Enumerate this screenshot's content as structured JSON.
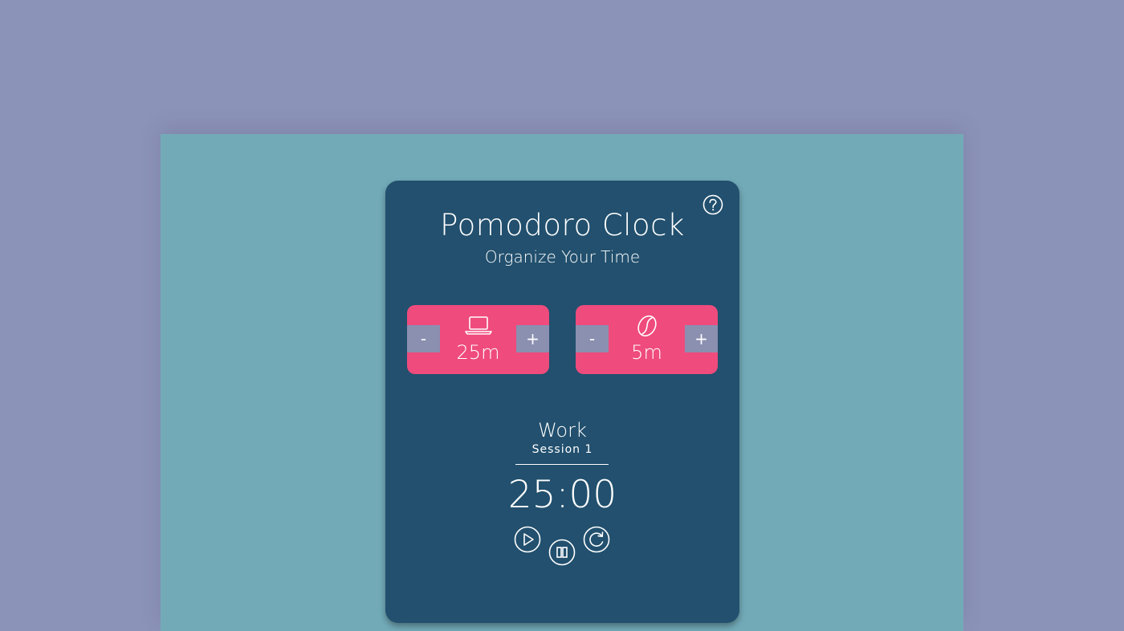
{
  "app": {
    "title": "Pomodoro Clock",
    "subtitle": "Organize Your Time"
  },
  "icons": {
    "help": "help-circle-icon",
    "work": "laptop-icon",
    "break": "coffee-bean-icon",
    "play": "play-icon",
    "pause": "pause-icon",
    "reset": "reset-icon"
  },
  "work_control": {
    "minus_label": "-",
    "plus_label": "+",
    "value": "25m"
  },
  "break_control": {
    "minus_label": "-",
    "plus_label": "+",
    "value": "5m"
  },
  "timer": {
    "mode": "Work",
    "session": "Session 1",
    "time": "25:00"
  },
  "colors": {
    "page_background": "#8c93b8",
    "stage_background": "#72aab8",
    "card_background": "#22506e",
    "control_background": "#ef4b7d",
    "button_background": "#8b8fb0",
    "text": "#ffffff"
  }
}
